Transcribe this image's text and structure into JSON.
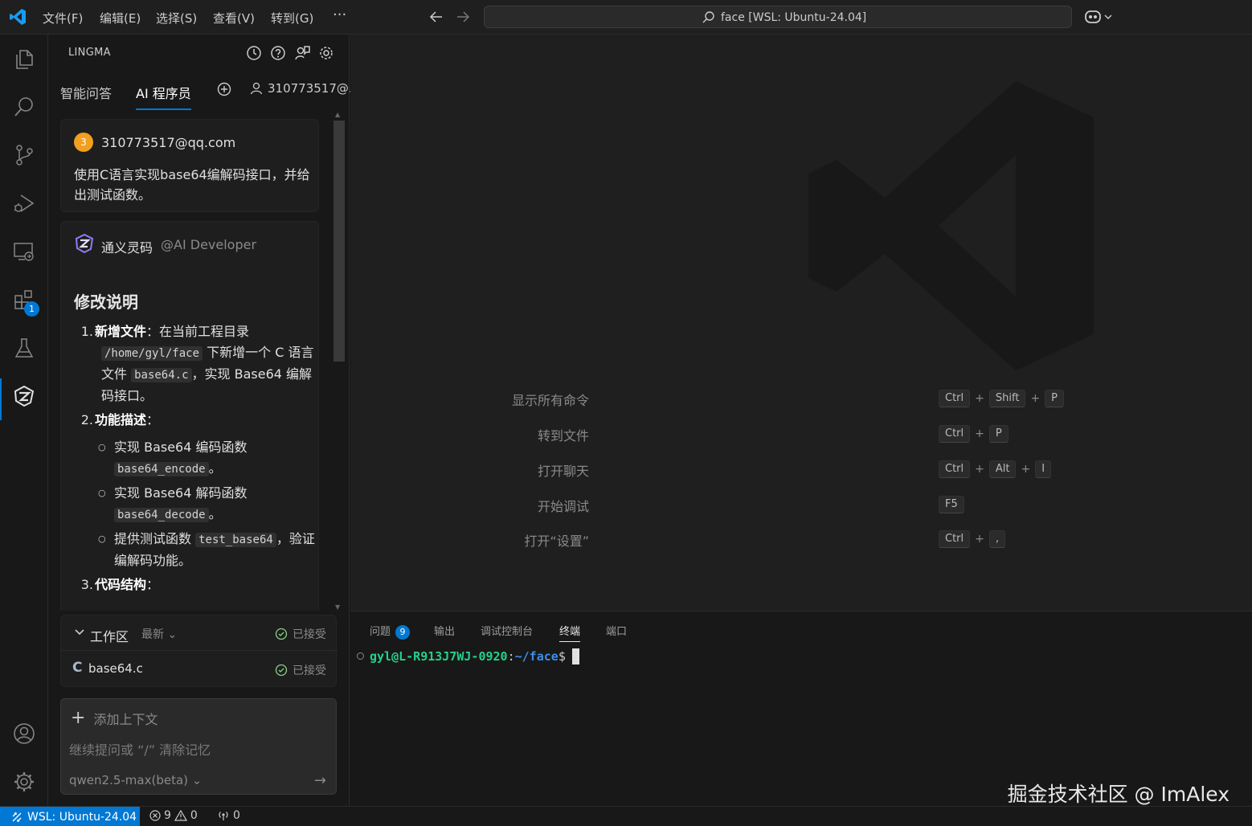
{
  "titlebar": {
    "menus": [
      "文件(F)",
      "编辑(E)",
      "选择(S)",
      "查看(V)",
      "转到(G)"
    ],
    "more": "···",
    "search_text": "face [WSL: Ubuntu-24.04]"
  },
  "activitybar": {
    "items": [
      "explorer",
      "search",
      "source-control",
      "run-and-debug",
      "remote-explorer",
      "extensions",
      "testing",
      "lingma"
    ],
    "extensions_badge": "1",
    "bottom": [
      "accounts",
      "manage"
    ]
  },
  "sidebar": {
    "title": "LINGMA",
    "tabs": [
      "智能问答",
      "AI 程序员"
    ],
    "active_tab": 1,
    "user": "310773517@..."
  },
  "chat": {
    "user_avatar": "3",
    "user_email": "310773517@qq.com",
    "user_message": "使用C语言实现base64编解码接口，并给出测试函数。",
    "ai_name": "通义灵码",
    "ai_handle": "@AI Developer",
    "heading": "修改说明",
    "item1_num": "1.",
    "item1_title": "新增文件",
    "item1_text_a": "：在当前工程目录",
    "item1_code1": "/home/gyl/face",
    "item1_text_b": " 下新增一个 C 语言文件 ",
    "item1_code2": "base64.c",
    "item1_text_c": "，实现 Base64 编解码接口。",
    "item2_num": "2.",
    "item2_title": "功能描述",
    "item2_colon": "：",
    "sub1_text": "实现 Base64 编码函数 ",
    "sub1_code": "base64_encode",
    "sub1_end": "。",
    "sub2_text": "实现 Base64 解码函数 ",
    "sub2_code": "base64_decode",
    "sub2_end": "。",
    "sub3_text": "提供测试函数 ",
    "sub3_code": "test_base64",
    "sub3_end": "，验证编解码功能。",
    "item3_num": "3.",
    "item3_title": "代码结构",
    "item3_colon": "："
  },
  "workspace": {
    "title": "工作区",
    "latest": "最新",
    "status": "已接受",
    "file_icon": "C",
    "file_name": "base64.c",
    "file_status": "已接受"
  },
  "input": {
    "add_context": "添加上下文",
    "placeholder": "继续提问或 “/” 清除记忆",
    "model": "qwen2.5-max(beta)"
  },
  "editor_shortcuts": [
    {
      "label": "显示所有命令",
      "keys": [
        "Ctrl",
        "Shift",
        "P"
      ]
    },
    {
      "label": "转到文件",
      "keys": [
        "Ctrl",
        "P"
      ]
    },
    {
      "label": "打开聊天",
      "keys": [
        "Ctrl",
        "Alt",
        "I"
      ]
    },
    {
      "label": "开始调试",
      "keys": [
        "F5"
      ]
    },
    {
      "label": "打开“设置”",
      "keys": [
        "Ctrl",
        ","
      ]
    }
  ],
  "panel": {
    "tabs": [
      "问题",
      "输出",
      "调试控制台",
      "终端",
      "端口"
    ],
    "active_tab": 3,
    "problems_count": "9",
    "terminal_user": "gyl@L-R913J7WJ-0920",
    "terminal_colon": ":",
    "terminal_path": "~/face",
    "terminal_prompt": "$"
  },
  "watermark": "掘金技术社区 @ ImAlex",
  "statusbar": {
    "remote": "WSL: Ubuntu-24.04",
    "errors": "9",
    "warnings": "0",
    "ports": "0"
  },
  "colors": {
    "accent": "#0078d4",
    "terminal_user": "#23d18b",
    "terminal_path": "#3b8eea"
  }
}
